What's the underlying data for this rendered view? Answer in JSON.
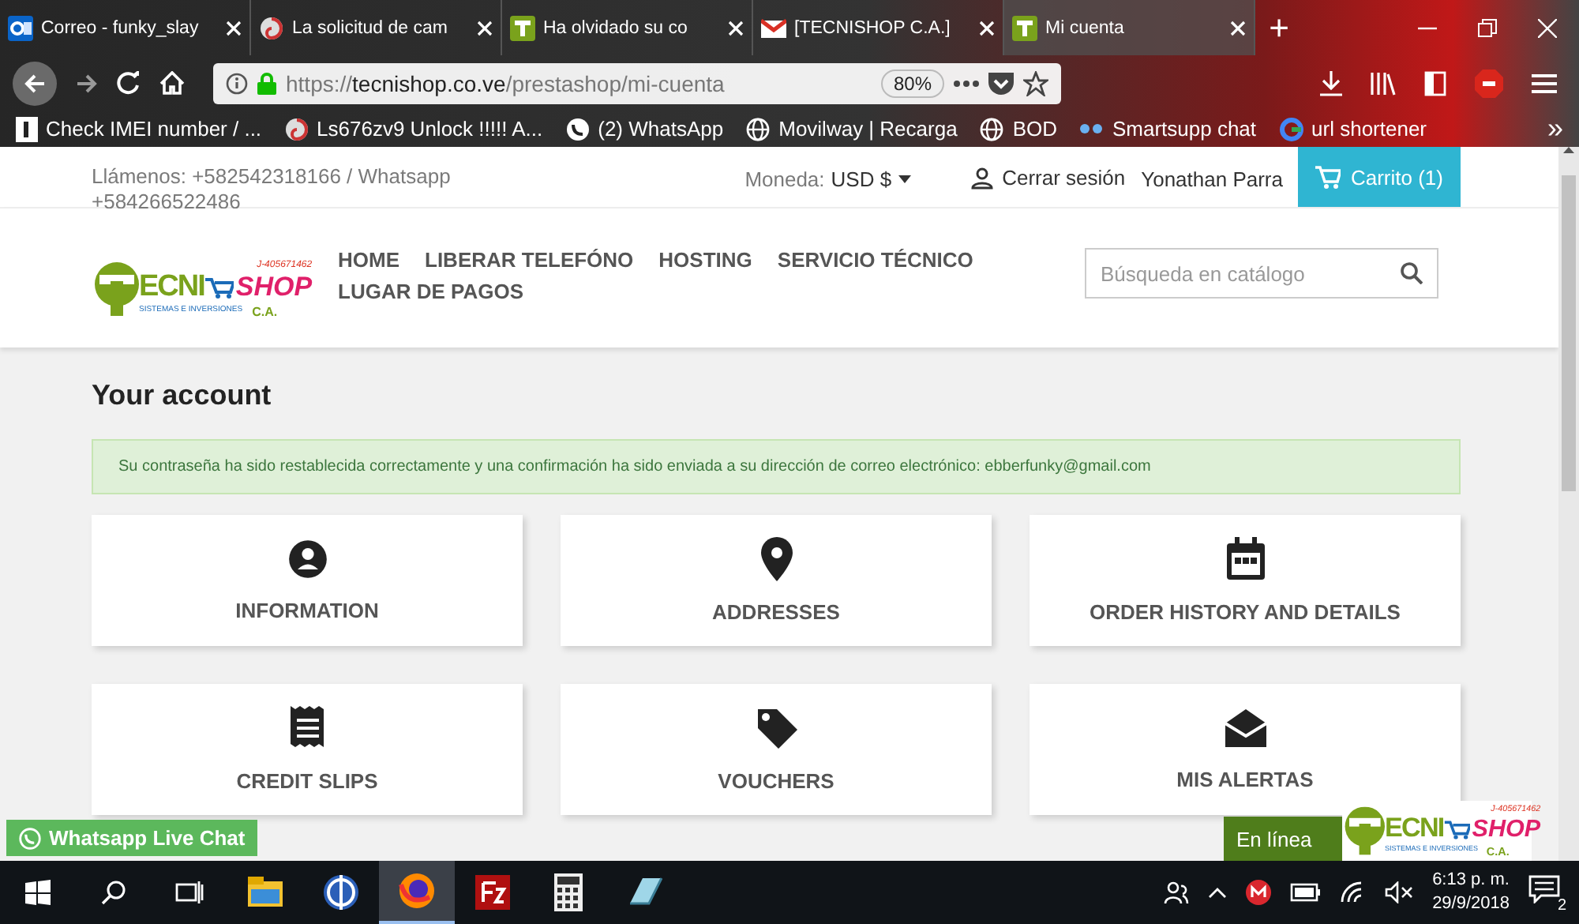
{
  "browser": {
    "tabs": [
      {
        "title": "Correo - funky_slay",
        "kind": "outlook",
        "selected": false
      },
      {
        "title": "La solicitud de cam",
        "kind": "swirl",
        "selected": false
      },
      {
        "title": "Ha olvidado su co",
        "kind": "shop",
        "selected": false
      },
      {
        "title": "[TECNISHOP C.A.]",
        "kind": "gmail",
        "selected": false
      },
      {
        "title": "Mi cuenta",
        "kind": "shop",
        "selected": true
      }
    ],
    "new_tab": "+",
    "url": {
      "scheme": "https://",
      "host": "tecnishop.co.ve",
      "path": "/prestashop/mi-cuenta"
    },
    "zoom": "80%",
    "bookmarks": [
      {
        "label": "Check IMEI number / ...",
        "kind": "page"
      },
      {
        "label": "Ls676zv9 Unlock !!!!! A...",
        "kind": "swirl"
      },
      {
        "label": "(2) WhatsApp",
        "kind": "whatsapp"
      },
      {
        "label": "Movilway | Recarga",
        "kind": "globe"
      },
      {
        "label": "BOD",
        "kind": "globe"
      },
      {
        "label": "Smartsupp chat",
        "kind": "dots"
      },
      {
        "label": "url shortener",
        "kind": "google"
      }
    ],
    "more": "»"
  },
  "header": {
    "contact": "Llámenos: +582542318166 / Whatsapp +584266522486",
    "currency_label": "Moneda:",
    "currency": "USD $",
    "logout": "Cerrar sesión",
    "user": "Yonathan Parra",
    "cart": "Carrito (1)"
  },
  "logo": {
    "code": "J-405671462",
    "left": "ECNI",
    "right": "SHOP",
    "tagline": "SISTEMAS E INVERSIONES",
    "suffix": "C.A."
  },
  "nav": [
    "HOME",
    "LIBERAR TELEFÓNO",
    "HOSTING",
    "SERVICIO TÉCNICO",
    "LUGAR DE PAGOS"
  ],
  "search": {
    "placeholder": "Búsqueda en catálogo"
  },
  "title": "Your account",
  "alert": "Su contraseña ha sido restablecida correctamente y una confirmación ha sido enviada a su dirección de correo electrónico: ebberfunky@gmail.com",
  "cards": [
    {
      "label": "INFORMATION",
      "kind": "person"
    },
    {
      "label": "ADDRESSES",
      "kind": "pin"
    },
    {
      "label": "ORDER HISTORY AND DETAILS",
      "kind": "calendar"
    },
    {
      "label": "CREDIT SLIPS",
      "kind": "receipt"
    },
    {
      "label": "VOUCHERS",
      "kind": "tag"
    },
    {
      "label": "MIS ALERTAS",
      "kind": "envelope"
    }
  ],
  "whatsapp_chat": "Whatsapp Live Chat",
  "live_chat": {
    "status": "En línea",
    "logo": {
      "code": "J-405671462",
      "left": "ECNI",
      "right": "SHOP",
      "tagline": "SISTEMAS E INVERSIONES",
      "suffix": "C.A."
    }
  },
  "taskbar": {
    "apps": [
      {
        "kind": "explorer",
        "selected": false
      },
      {
        "kind": "globe",
        "selected": false
      },
      {
        "kind": "firefox",
        "selected": true
      },
      {
        "kind": "filezilla",
        "selected": false
      },
      {
        "kind": "calculator",
        "selected": false
      },
      {
        "kind": "notepad",
        "selected": false
      }
    ],
    "time": "6:13 p. m.",
    "date": "29/9/2018",
    "notifications": "2"
  }
}
